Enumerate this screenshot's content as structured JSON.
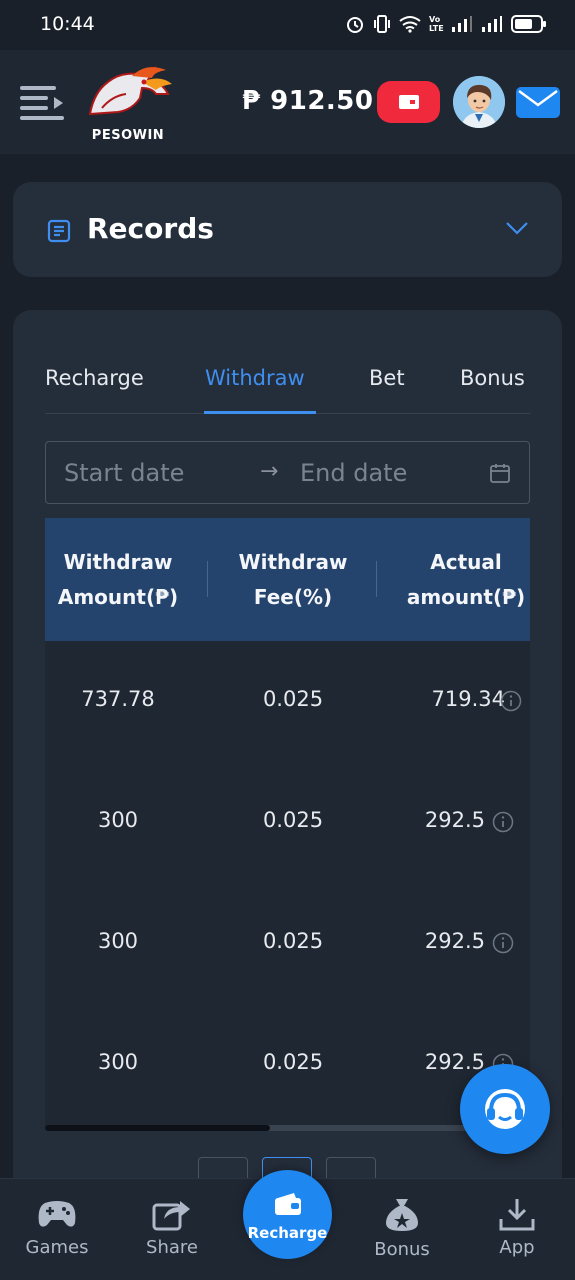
{
  "status_bar": {
    "time": "10:44",
    "network_label": "Vo LTE"
  },
  "header": {
    "logo_text": "PESOWIN",
    "balance": "₱ 912.50",
    "icons": [
      "menu-icon",
      "wallet-icon",
      "avatar",
      "mail-icon"
    ]
  },
  "records": {
    "title": "Records"
  },
  "tabs": [
    {
      "label": "Recharge"
    },
    {
      "label": "Withdraw",
      "active": true
    },
    {
      "label": "Bet"
    },
    {
      "label": "Bonus"
    }
  ],
  "date_range": {
    "start_placeholder": "Start date",
    "separator": "→",
    "end_placeholder": "End date"
  },
  "table": {
    "headers": [
      "Withdraw Amount(₱)",
      "Withdraw Fee(%)",
      "Actual amount(₱)"
    ],
    "header_lines": [
      [
        "Withdraw",
        "Amount(₱)"
      ],
      [
        "Withdraw",
        "Fee(%)"
      ],
      [
        "Actual",
        "amount(₱)"
      ]
    ],
    "rows": [
      {
        "amount": "737.78",
        "fee": "0.025",
        "actual": "719.34"
      },
      {
        "amount": "300",
        "fee": "0.025",
        "actual": "292.5"
      },
      {
        "amount": "300",
        "fee": "0.025",
        "actual": "292.5"
      },
      {
        "amount": "300",
        "fee": "0.025",
        "actual": "292.5"
      }
    ]
  },
  "bottom_nav": {
    "games": "Games",
    "share": "Share",
    "recharge": "Recharge",
    "bonus": "Bonus",
    "app": "App"
  },
  "colors": {
    "accent": "#3f8ff0",
    "primary_button": "#1e88f0",
    "wallet_red": "#f02a3c",
    "table_header": "#24446e"
  }
}
